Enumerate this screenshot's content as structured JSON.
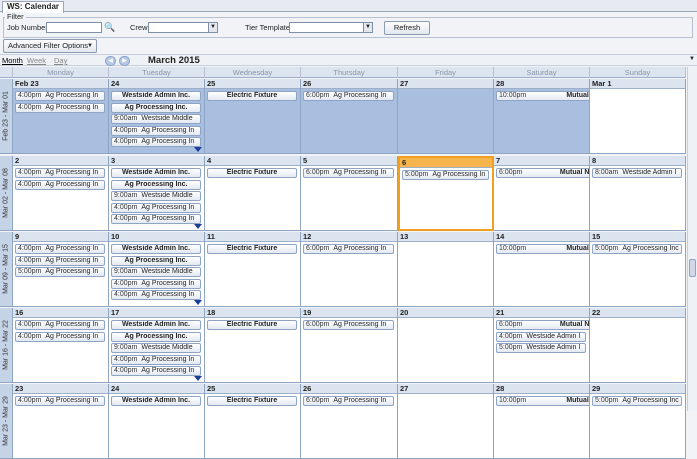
{
  "window": {
    "tab_title": "WS: Calendar"
  },
  "filter": {
    "legend": "Filter",
    "job_number_label": "Job Number",
    "job_number_value": "",
    "crew_label": "Crew",
    "crew_value": "",
    "tier_label": "Tier Template",
    "tier_value": "",
    "refresh_label": "Refresh",
    "advanced_label": "Advanced Filter Options"
  },
  "view": {
    "tabs": [
      "Month",
      "Week",
      "Day"
    ],
    "active_tab": "Month",
    "month_title": "March 2015"
  },
  "day_headers": [
    "Monday",
    "Tuesday",
    "Wednesday",
    "Thursday",
    "Friday",
    "Saturday",
    "Sunday"
  ],
  "weeks": [
    {
      "label": "Feb 23 - Mar 01",
      "days": [
        {
          "date": "Feb 23",
          "other": true,
          "events": [
            {
              "time": "4:00pm",
              "text": "Ag Processing In"
            },
            {
              "time": "4:00pm",
              "text": "Ag Processing In"
            }
          ]
        },
        {
          "date": "24",
          "other": true,
          "more": true,
          "events": [
            {
              "time": "",
              "text": "Westside Admin Inc.",
              "bold": true
            },
            {
              "time": "",
              "text": "Ag Processing Inc.",
              "bold": true
            },
            {
              "time": "9:00am",
              "text": "Westside Middle"
            },
            {
              "time": "4:00pm",
              "text": "Ag Processing In"
            },
            {
              "time": "4:00pm",
              "text": "Ag Processing In"
            }
          ]
        },
        {
          "date": "25",
          "other": true,
          "events": [
            {
              "time": "",
              "text": "Electric Fixture",
              "bold": true
            }
          ]
        },
        {
          "date": "26",
          "other": true,
          "events": [
            {
              "time": "6:00pm",
              "text": "Ag Processing In"
            }
          ]
        },
        {
          "date": "27",
          "other": true,
          "events": []
        },
        {
          "date": "28",
          "other": true,
          "span": true,
          "events": [
            {
              "time": "10:00pm",
              "text": "Mutual South",
              "bold": true
            }
          ]
        },
        {
          "date": "Mar 1",
          "other": false,
          "events": []
        }
      ]
    },
    {
      "label": "Mar 02 - Mar 08",
      "days": [
        {
          "date": "2",
          "other": false,
          "events": [
            {
              "time": "4:00pm",
              "text": "Ag Processing In"
            },
            {
              "time": "4:00pm",
              "text": "Ag Processing In"
            }
          ]
        },
        {
          "date": "3",
          "other": false,
          "more": true,
          "events": [
            {
              "time": "",
              "text": "Westside Admin Inc.",
              "bold": true
            },
            {
              "time": "",
              "text": "Ag Processing Inc.",
              "bold": true
            },
            {
              "time": "9:00am",
              "text": "Westside Middle"
            },
            {
              "time": "4:00pm",
              "text": "Ag Processing In"
            },
            {
              "time": "4:00pm",
              "text": "Ag Processing In"
            }
          ]
        },
        {
          "date": "4",
          "other": false,
          "events": [
            {
              "time": "",
              "text": "Electric Fixture",
              "bold": true
            }
          ]
        },
        {
          "date": "5",
          "other": false,
          "events": [
            {
              "time": "6:00pm",
              "text": "Ag Processing In"
            }
          ]
        },
        {
          "date": "6",
          "other": false,
          "today": true,
          "events": [
            {
              "time": "5:00pm",
              "text": "Ag Processing In"
            }
          ]
        },
        {
          "date": "7",
          "other": false,
          "span": true,
          "events": [
            {
              "time": "6:00pm",
              "text": "Mutual Northeast",
              "bold": true
            }
          ]
        },
        {
          "date": "8",
          "other": false,
          "events": [
            {
              "time": "8:00am",
              "text": "Westside Admin I"
            }
          ]
        }
      ]
    },
    {
      "label": "Mar 09 - Mar 15",
      "days": [
        {
          "date": "9",
          "other": false,
          "events": [
            {
              "time": "4:00pm",
              "text": "Ag Processing In"
            },
            {
              "time": "4:00pm",
              "text": "Ag Processing In"
            },
            {
              "time": "5:00pm",
              "text": "Ag Processing In"
            }
          ]
        },
        {
          "date": "10",
          "other": false,
          "more": true,
          "events": [
            {
              "time": "",
              "text": "Westside Admin Inc.",
              "bold": true
            },
            {
              "time": "",
              "text": "Ag Processing Inc.",
              "bold": true
            },
            {
              "time": "9:00am",
              "text": "Westside Middle"
            },
            {
              "time": "4:00pm",
              "text": "Ag Processing In"
            },
            {
              "time": "4:00pm",
              "text": "Ag Processing In"
            }
          ]
        },
        {
          "date": "11",
          "other": false,
          "events": [
            {
              "time": "",
              "text": "Electric Fixture",
              "bold": true
            }
          ]
        },
        {
          "date": "12",
          "other": false,
          "events": [
            {
              "time": "6:00pm",
              "text": "Ag Processing In"
            }
          ]
        },
        {
          "date": "13",
          "other": false,
          "events": []
        },
        {
          "date": "14",
          "other": false,
          "span": true,
          "events": [
            {
              "time": "10:00pm",
              "text": "Mutual South",
              "bold": true
            }
          ]
        },
        {
          "date": "15",
          "other": false,
          "events": [
            {
              "time": "5:00pm",
              "text": "Ag Processing Inc"
            }
          ]
        }
      ]
    },
    {
      "label": "Mar 16 - Mar 22",
      "days": [
        {
          "date": "16",
          "other": false,
          "events": [
            {
              "time": "4:00pm",
              "text": "Ag Processing In"
            },
            {
              "time": "4:00pm",
              "text": "Ag Processing In"
            }
          ]
        },
        {
          "date": "17",
          "other": false,
          "more": true,
          "events": [
            {
              "time": "",
              "text": "Westside Admin Inc.",
              "bold": true
            },
            {
              "time": "",
              "text": "Ag Processing Inc.",
              "bold": true
            },
            {
              "time": "9:00am",
              "text": "Westside Middle"
            },
            {
              "time": "4:00pm",
              "text": "Ag Processing In"
            },
            {
              "time": "4:00pm",
              "text": "Ag Processing In"
            }
          ]
        },
        {
          "date": "18",
          "other": false,
          "events": [
            {
              "time": "",
              "text": "Electric Fixture",
              "bold": true
            }
          ]
        },
        {
          "date": "19",
          "other": false,
          "events": [
            {
              "time": "6:00pm",
              "text": "Ag Processing In"
            }
          ]
        },
        {
          "date": "20",
          "other": false,
          "events": []
        },
        {
          "date": "21",
          "other": false,
          "span": true,
          "events": [
            {
              "time": "6:00pm",
              "text": "Mutual Northeast",
              "bold": true
            },
            {
              "time": "4:00pm",
              "text": "Westside Admin I"
            },
            {
              "time": "5:00pm",
              "text": "Westside Admin I"
            }
          ]
        },
        {
          "date": "22",
          "other": false,
          "events": []
        }
      ]
    },
    {
      "label": "Mar 23 - Mar 29",
      "days": [
        {
          "date": "23",
          "other": false,
          "events": [
            {
              "time": "4:00pm",
              "text": "Ag Processing In"
            }
          ]
        },
        {
          "date": "24",
          "other": false,
          "events": [
            {
              "time": "",
              "text": "Westside Admin Inc.",
              "bold": true
            }
          ]
        },
        {
          "date": "25",
          "other": false,
          "events": [
            {
              "time": "",
              "text": "Electric Fixture",
              "bold": true
            }
          ]
        },
        {
          "date": "26",
          "other": false,
          "events": [
            {
              "time": "6:00pm",
              "text": "Ag Processing In"
            }
          ]
        },
        {
          "date": "27",
          "other": false,
          "events": []
        },
        {
          "date": "28",
          "other": false,
          "span": true,
          "events": [
            {
              "time": "10:00pm",
              "text": "Mutual South",
              "bold": true
            }
          ]
        },
        {
          "date": "29",
          "other": false,
          "events": [
            {
              "time": "5:00pm",
              "text": "Ag Processing Inc"
            }
          ]
        }
      ]
    }
  ]
}
